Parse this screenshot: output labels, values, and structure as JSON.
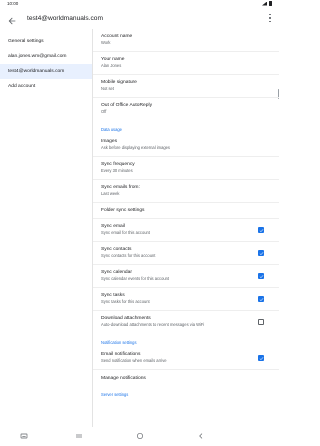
{
  "status": {
    "time": "10:00"
  },
  "app_bar": {
    "title": "test4@worldmanuals.com",
    "back_icon": "back-arrow-icon",
    "menu_icon": "more-vert-icon"
  },
  "sidebar": {
    "items": [
      {
        "label": "General settings"
      },
      {
        "label": "alan.jones.wm@gmail.com"
      },
      {
        "label": "test4@worldmanuals.com"
      },
      {
        "label": "Add account"
      }
    ]
  },
  "settings": {
    "account_name": {
      "title": "Account name",
      "value": "Work"
    },
    "your_name": {
      "title": "Your name",
      "value": "Alan Jones"
    },
    "mobile_signature": {
      "title": "Mobile signature",
      "value": "Not set"
    },
    "out_of_office": {
      "title": "Out of Office AutoReply",
      "value": "Off"
    },
    "data_usage_header": "Data usage",
    "images": {
      "title": "Images",
      "value": "Ask before displaying external images"
    },
    "sync_frequency": {
      "title": "Sync frequency",
      "value": "Every 30 minutes"
    },
    "sync_emails_from": {
      "title": "Sync emails from:",
      "value": "Last week"
    },
    "folder_sync": {
      "title": "Folder sync settings"
    },
    "sync_email": {
      "title": "Sync email",
      "value": "Sync email for this account",
      "checked": true
    },
    "sync_contacts": {
      "title": "Sync contacts",
      "value": "Sync contacts for this account",
      "checked": true
    },
    "sync_calendar": {
      "title": "Sync calendar",
      "value": "Sync calendar events for this account",
      "checked": true
    },
    "sync_tasks": {
      "title": "Sync tasks",
      "value": "Sync tasks for this account",
      "checked": true
    },
    "download_attachments": {
      "title": "Download attachments",
      "value": "Auto-download attachments to recent messages via WiFi",
      "checked": false
    },
    "notification_header": "Notification settings",
    "email_notifications": {
      "title": "Email notifications",
      "value": "Send notification when emails arrive",
      "checked": true
    },
    "manage_notifications": {
      "title": "Manage notifications"
    },
    "server_header": "Server settings"
  },
  "colors": {
    "accent": "#1a73e8",
    "selected_bg": "#e8f0fe"
  }
}
